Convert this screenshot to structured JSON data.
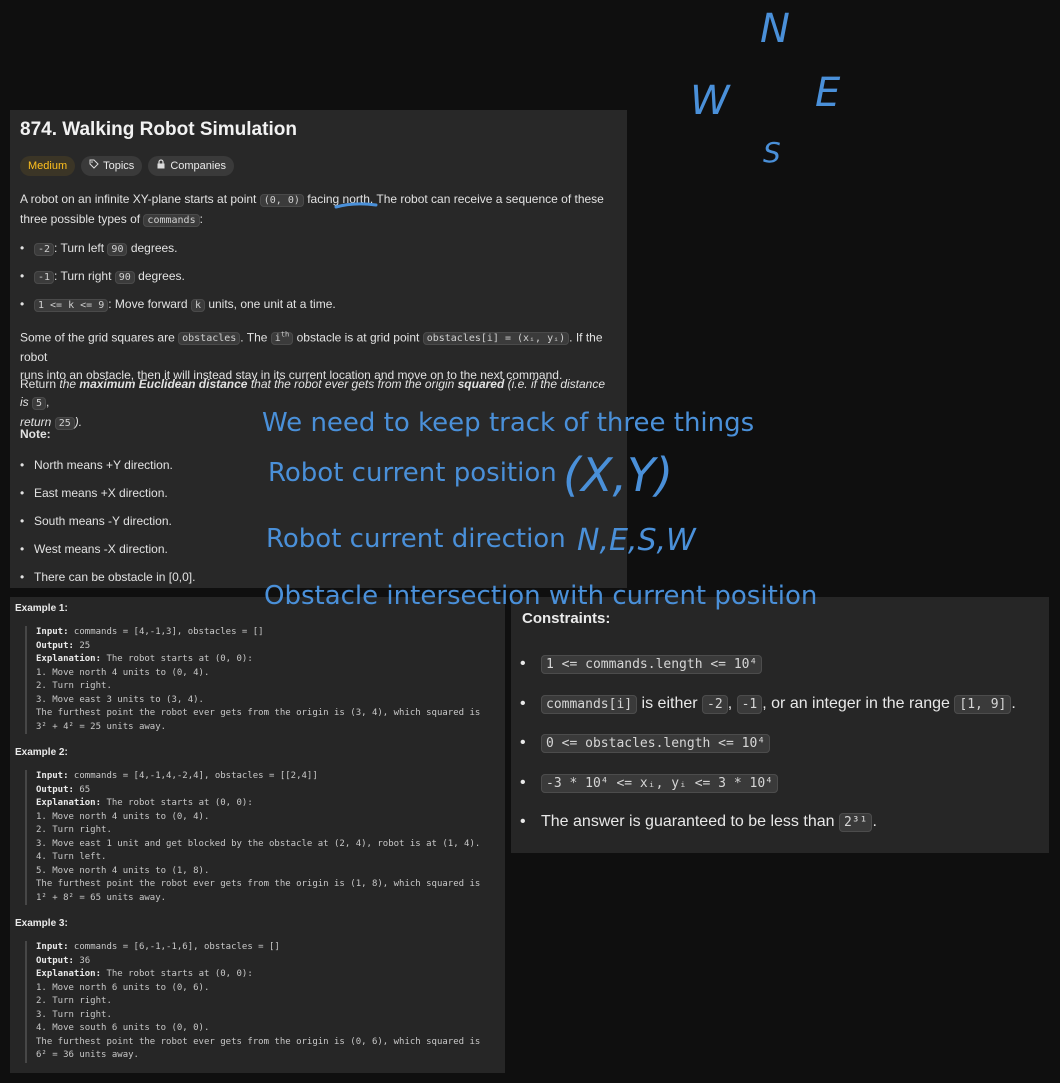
{
  "problem": {
    "title": "874. Walking Robot Simulation",
    "tags": {
      "difficulty": "Medium",
      "topics": "Topics",
      "companies": "Companies"
    },
    "intro_1": "A robot on an infinite XY-plane starts at point",
    "intro_code_start": "(0, 0)",
    "intro_2": "facing north. The robot can receive a sequence of these",
    "intro_3": "three possible types of",
    "intro_code_commands": "commands",
    "intro_colon": ":",
    "cmd_list": [
      {
        "code": "-2",
        "text": ": Turn left",
        "num": "90",
        "tail": "degrees."
      },
      {
        "code": "-1",
        "text": ": Turn right",
        "num": "90",
        "tail": "degrees."
      },
      {
        "code": "1 <= k <= 9",
        "text": ": Move forward",
        "num": "k",
        "tail": "units, one unit at a time."
      }
    ],
    "obs_1": "Some of the grid squares are",
    "obs_code": "obstacles",
    "obs_2": ". The",
    "obs_ith": "i",
    "obs_ith_sup": "th",
    "obs_3": "obstacle is at grid point",
    "obs_code2": "obstacles[i] = (xᵢ, yᵢ)",
    "obs_4": ". If the robot",
    "obs_5": "runs into an obstacle, then it will instead stay in its current location and move on to the next command.",
    "ret_1": "Return",
    "ret_the": "the",
    "ret_bold1": "maximum Euclidean distance",
    "ret_2": "that the robot ever gets from the origin",
    "ret_bold2": "squared",
    "ret_3": "(i.e. if the distance is",
    "ret_code1": "5",
    "ret_4": ",",
    "ret_5": "return",
    "ret_code2": "25",
    "ret_6": ").",
    "note_title": "Note:",
    "notes": [
      "North means +Y direction.",
      "East means +X direction.",
      "South means -Y direction.",
      "West means -X direction.",
      "There can be obstacle in [0,0]."
    ]
  },
  "examples": [
    {
      "heading": "Example 1:",
      "input_label": "Input:",
      "input": " commands = [4,-1,3], obstacles = []",
      "output_label": "Output:",
      "output": " 25",
      "expl_label": "Explanation:",
      "expl": " The robot starts at (0, 0):",
      "lines": [
        "1. Move north 4 units to (0, 4).",
        "2. Turn right.",
        "3. Move east 3 units to (3, 4).",
        "The furthest point the robot ever gets from the origin is (3, 4), which squared is",
        "3² + 4² = 25 units away."
      ]
    },
    {
      "heading": "Example 2:",
      "input_label": "Input:",
      "input": " commands = [4,-1,4,-2,4], obstacles = [[2,4]]",
      "output_label": "Output:",
      "output": " 65",
      "expl_label": "Explanation:",
      "expl": " The robot starts at (0, 0):",
      "lines": [
        "1. Move north 4 units to (0, 4).",
        "2. Turn right.",
        "3. Move east 1 unit and get blocked by the obstacle at (2, 4), robot is at (1, 4).",
        "4. Turn left.",
        "5. Move north 4 units to (1, 8).",
        "The furthest point the robot ever gets from the origin is (1, 8), which squared is",
        "1² + 8² = 65 units away."
      ]
    },
    {
      "heading": "Example 3:",
      "input_label": "Input:",
      "input": " commands = [6,-1,-1,6], obstacles = []",
      "output_label": "Output:",
      "output": " 36",
      "expl_label": "Explanation:",
      "expl": " The robot starts at (0, 0):",
      "lines": [
        "1. Move north 6 units to (0, 6).",
        "2. Turn right.",
        "3. Turn right.",
        "4. Move south 6 units to (0, 0).",
        "The furthest point the robot ever gets from the origin is (0, 6), which squared is",
        "6² = 36 units away."
      ]
    }
  ],
  "constraints": {
    "title": "Constraints:",
    "c1_code": "1 <= commands.length <= 10⁴",
    "c2_code1": "commands[i]",
    "c2_t1": "is either",
    "c2_code2": "-2",
    "c2_t2": ",",
    "c2_code3": "-1",
    "c2_t3": ", or an integer in the range",
    "c2_code4": "[1, 9]",
    "c2_t4": ".",
    "c3_code": "0 <= obstacles.length <= 10⁴",
    "c4_code": "-3 * 10⁴ <= xᵢ, yᵢ <= 3 * 10⁴",
    "c5_text": "The answer is guaranteed to be less than",
    "c5_code": "2³¹",
    "c5_tail": "."
  },
  "annotations": {
    "compass_n": "N",
    "compass_w": "W",
    "compass_e": "E",
    "compass_s": "S",
    "line1": "We need to keep track of three things",
    "line2": "Robot current position",
    "hand_xy": "(X,Y)",
    "line3": "Robot current direction",
    "hand_dirs": "N,E,S,W",
    "line4": "Obstacle intersection with current position"
  },
  "colors": {
    "annotation": "#4a90d9",
    "medium": "#ffc01e",
    "panel": "#282828",
    "background": "#0f0f0f"
  }
}
